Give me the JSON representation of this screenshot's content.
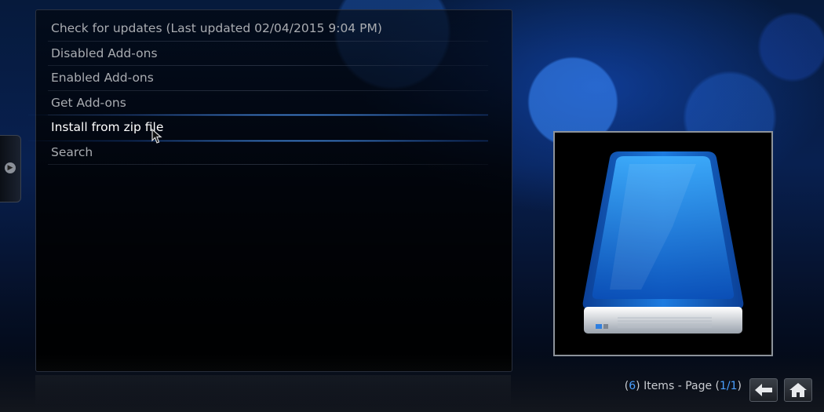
{
  "menu": {
    "items": [
      {
        "label": "Check for updates (Last updated 02/04/2015 9:04 PM)"
      },
      {
        "label": "Disabled Add-ons"
      },
      {
        "label": "Enabled Add-ons"
      },
      {
        "label": "Get Add-ons"
      },
      {
        "label": "Install from zip file"
      },
      {
        "label": "Search"
      }
    ],
    "focused_index": 4
  },
  "status": {
    "count": "6",
    "items_text": " Items - Page (",
    "page": "1/1",
    "close_paren": ")",
    "open_paren": "("
  },
  "icons": {
    "side_tab": "chevron-right-icon",
    "back": "back-arrow-icon",
    "home": "home-icon",
    "thumbnail": "hard-drive-icon"
  },
  "colors": {
    "accent": "#4aa0ff",
    "highlight": "#5aaaff",
    "text": "#a9acb1",
    "text_focused": "#ffffff"
  }
}
